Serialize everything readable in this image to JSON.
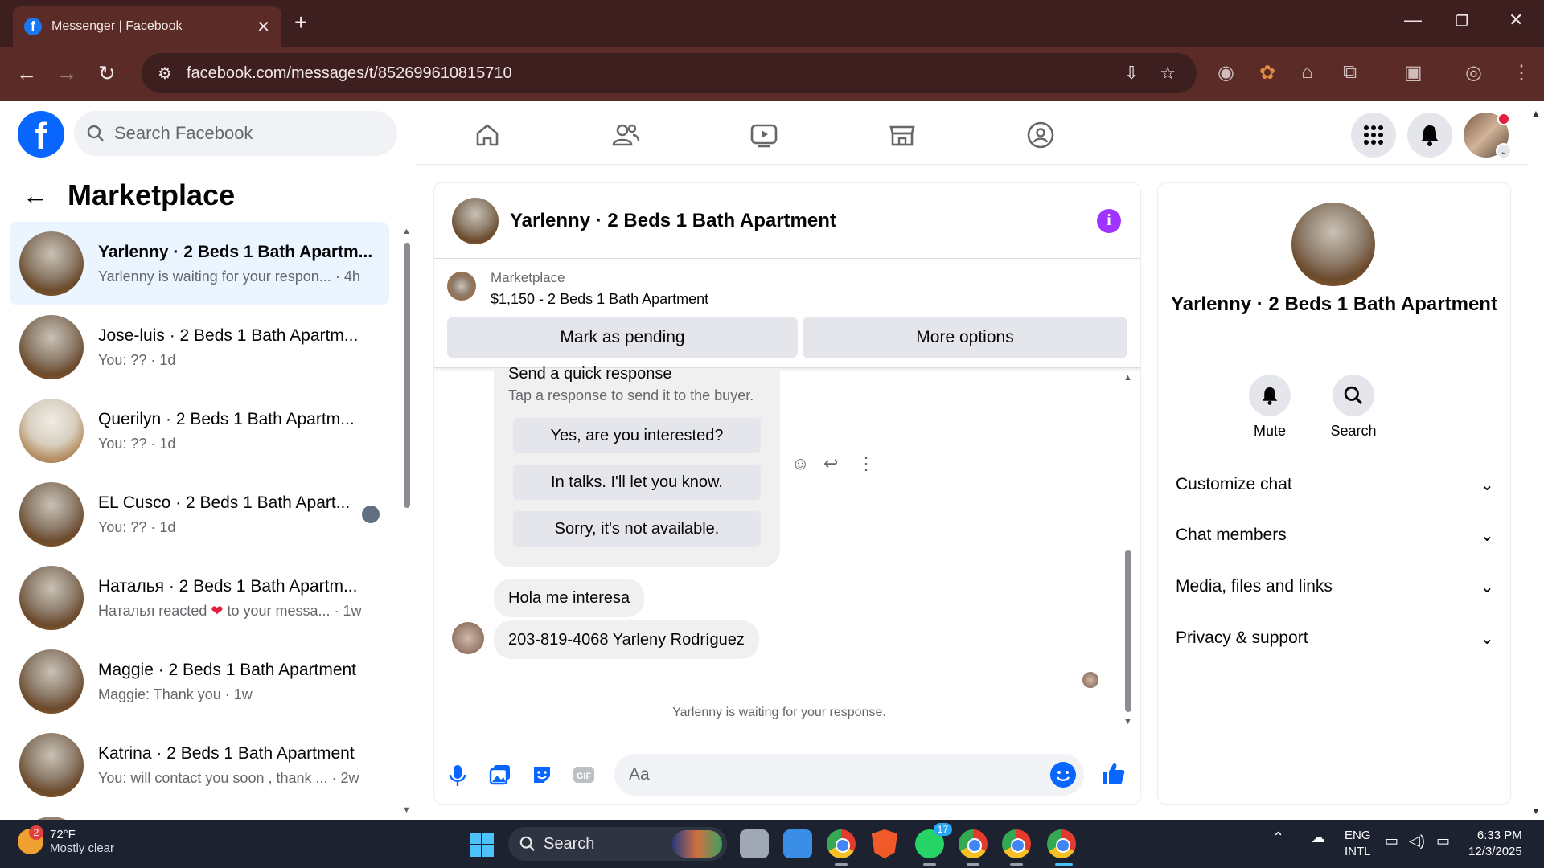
{
  "browser": {
    "tab_title": "Messenger | Facebook",
    "url": "facebook.com/messages/t/852699610815710"
  },
  "fb": {
    "search_placeholder": "Search Facebook"
  },
  "sidebar": {
    "title": "Marketplace",
    "conversations": [
      {
        "name": "Yarlenny · 2 Beds 1 Bath Apartm...",
        "preview": "Yarlenny is waiting for your respon...",
        "time": "· 4h",
        "selected": true
      },
      {
        "name": "Jose-luis · 2 Beds 1 Bath Apartm...",
        "preview": "You: ??",
        "time": "· 1d"
      },
      {
        "name": "Querilyn · 2 Beds 1 Bath Apartm...",
        "preview": "You: ??",
        "time": "· 1d"
      },
      {
        "name": "EL Cusco · 2 Beds 1 Bath Apart...",
        "preview": "You: ??",
        "time": "· 1d"
      },
      {
        "name": "Наталья · 2 Beds 1 Bath Apartm...",
        "preview_a": "Наталья reacted",
        "preview_b": "to your messa...",
        "time": "· 1w"
      },
      {
        "name": "Maggie · 2 Beds 1 Bath Apartment",
        "preview": "Maggie: Thank you",
        "time": "· 1w"
      },
      {
        "name": "Katrina · 2 Beds 1 Bath Apartment",
        "preview": "You: will contact you soon , thank ...",
        "time": "· 2w"
      }
    ]
  },
  "chat": {
    "title": "Yarlenny · 2 Beds 1 Bath Apartment",
    "marketplace_label": "Marketplace",
    "listing": "$1,150 - 2 Beds 1 Bath Apartment",
    "mark_pending": "Mark as pending",
    "more_options": "More options",
    "quick_title": "Send a quick response",
    "quick_sub": "Tap a response to send it to the buyer.",
    "quick_replies": [
      "Yes, are you interested?",
      "In talks. I'll let you know.",
      "Sorry, it's not available."
    ],
    "messages": [
      "Hola me interesa",
      "203-819-4068 Yarleny Rodríguez"
    ],
    "waiting": "Yarlenny is waiting for your response.",
    "composer_placeholder": "Aa"
  },
  "info": {
    "name": "Yarlenny · 2 Beds 1 Bath Apartment",
    "mute": "Mute",
    "search": "Search",
    "rows": [
      "Customize chat",
      "Chat members",
      "Media, files and links",
      "Privacy & support"
    ]
  },
  "taskbar": {
    "weather_temp": "72°F",
    "weather_desc": "Mostly clear",
    "weather_badge": "2",
    "search": "Search",
    "whatsapp_badge": "17",
    "lang1": "ENG",
    "lang2": "INTL",
    "time": "6:33 PM",
    "date": "12/3/2025"
  },
  "colors": {
    "fb_blue": "#0866ff",
    "chrome_frame": "#3c1f1e",
    "chrome_toolbar": "#5a2b27",
    "selected_conv": "#ebf5ff",
    "info_purple": "#a033ff"
  }
}
